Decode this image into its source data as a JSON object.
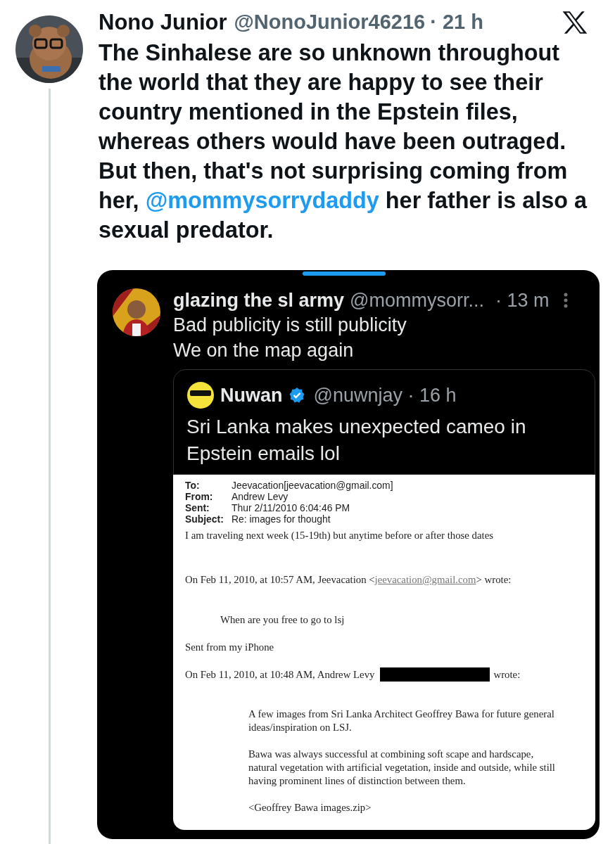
{
  "tweet": {
    "author": "Nono Junior",
    "handle": "@NonoJunior46216",
    "time": "· 21 h",
    "text": [
      {
        "kind": "plain",
        "text": "The Sinhalese are so unknown throughout the world that they are happy to see their country mentioned in the Epstein files, whereas others would have been outraged. But then, that's not surprising coming from her, "
      },
      {
        "kind": "mention",
        "text": "@mommysorrydaddy"
      },
      {
        "kind": "plain",
        "text": " her father is also a sexual predator."
      }
    ]
  },
  "screenshot": {
    "reply": {
      "author": "glazing the sl army",
      "handle": "@mommysorr...",
      "time": "· 13 m",
      "lines": [
        "Bad publicity is still publicity",
        "We on the map again"
      ]
    },
    "quote": {
      "author": "Nuwan",
      "verified": true,
      "handle": "@nuwnjay · 16 h",
      "text": "Sri Lanka makes unexpected cameo in Epstein emails lol"
    },
    "email": {
      "headers": [
        {
          "label": "To:",
          "value": "Jeevacation[jeevacation@gmail.com]"
        },
        {
          "label": "From:",
          "value": "Andrew Levy"
        },
        {
          "label": "Sent:",
          "value": "Thur 2/11/2010 6:04:46 PM"
        },
        {
          "label": "Subject:",
          "value": "Re: images for thought"
        }
      ],
      "blocks": [
        {
          "kind": "para",
          "text": "I am traveling next week (15-19th) but anytime before or after those dates"
        },
        {
          "kind": "linkline",
          "before": "On Feb 11, 2010, at 10:57 AM, Jeevacation <",
          "link": "jeevacation@gmail.com",
          "after": "> wrote:"
        },
        {
          "kind": "indent1",
          "text": "When are you free to go to lsj"
        },
        {
          "kind": "para",
          "text": "Sent from my iPhone"
        },
        {
          "kind": "redacted",
          "before": "On Feb 11, 2010, at 10:48 AM, Andrew Levy",
          "after": "wrote:"
        },
        {
          "kind": "indent2",
          "text": "A few images from Sri Lanka Architect Geoffrey Bawa for future general ideas/inspiration on LSJ."
        },
        {
          "kind": "indent2",
          "text": "Bawa was always successful at combining soft scape and hardscape, natural vegetation with artificial vegetation, inside and outside, while still having prominent lines of distinction between them."
        },
        {
          "kind": "indent2",
          "text": "<Geoffrey Bawa images.zip>"
        }
      ]
    }
  }
}
